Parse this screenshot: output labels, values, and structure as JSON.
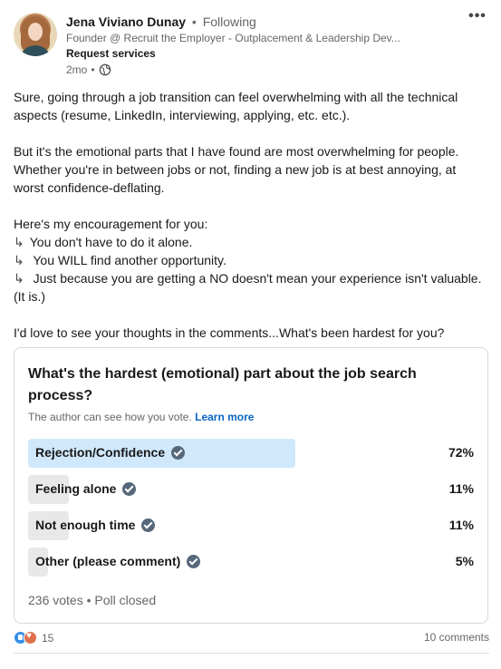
{
  "author": {
    "name": "Jena Viviano Dunay",
    "following": "Following",
    "headline": "Founder @ Recruit the Employer - Outplacement & Leadership Dev...",
    "services": "Request services",
    "time": "2mo",
    "visibility_icon": "globe-icon"
  },
  "post": {
    "paragraphs": [
      "Sure, going through a job transition can feel overwhelming with all the technical aspects (resume, LinkedIn, interviewing, applying, etc. etc.).",
      "",
      "But it's the emotional parts that I have found are most overwhelming for people. Whether you're in between jobs or not, finding a new job is at best annoying, at worst confidence-deflating.",
      "",
      "Here's my encouragement for you:"
    ],
    "bullets": [
      "You don't have to do it alone.",
      " You WILL find another opportunity.",
      " Just because you are getting a NO doesn't mean your experience isn't valuable. (It is.)"
    ],
    "closing": "I'd love to see your thoughts in the comments...What's been hardest for you?"
  },
  "poll": {
    "question": "What's the hardest (emotional) part about the job search process?",
    "note": "The author can see how you vote.",
    "learn_more": "Learn more",
    "options": [
      {
        "label": "Rejection/Confidence",
        "percent": "72%",
        "fraction": 0.72,
        "selected": true
      },
      {
        "label": "Feeling alone",
        "percent": "11%",
        "fraction": 0.11,
        "selected": false
      },
      {
        "label": "Not enough time",
        "percent": "11%",
        "fraction": 0.11,
        "selected": false
      },
      {
        "label": "Other (please comment)",
        "percent": "5%",
        "fraction": 0.05,
        "selected": false
      }
    ],
    "votes": "236 votes",
    "status": "Poll closed"
  },
  "social": {
    "reaction_count": "15",
    "comments": "10 comments"
  },
  "colors": {
    "link": "#0a66c2",
    "selected_bar": "#d0e8fb",
    "bar": "#e8e8e8"
  }
}
